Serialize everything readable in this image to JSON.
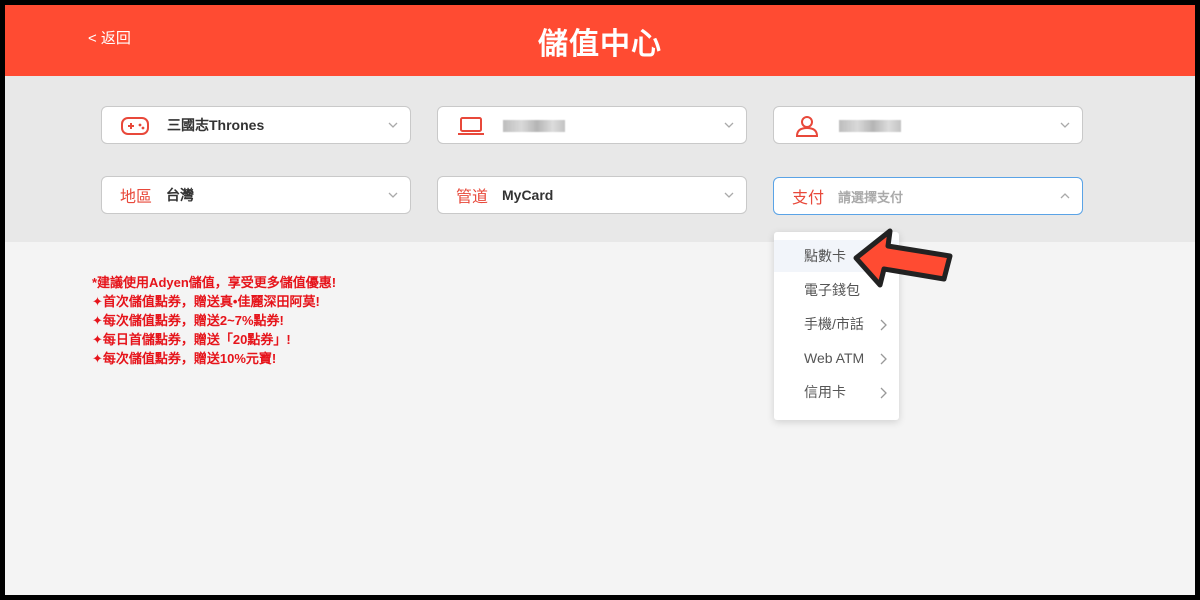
{
  "header": {
    "back_label": "< 返回",
    "title": "儲值中心",
    "bg_color": "#ff4b32"
  },
  "selectors": {
    "game": {
      "value": "三國志Thrones",
      "icon": "gamepad-icon"
    },
    "server": {
      "value": "",
      "icon": "laptop-icon"
    },
    "character": {
      "value": "",
      "icon": "user-icon"
    },
    "region": {
      "label": "地區",
      "value": "台灣"
    },
    "channel": {
      "label": "管道",
      "value": "MyCard"
    },
    "payment": {
      "label": "支付",
      "placeholder": "請選擇支付"
    }
  },
  "promo": {
    "lines": [
      "*建議使用Adyen儲值，享受更多儲值優惠!",
      "✦首次儲值點券，贈送真•佳麗深田阿莫!",
      "✦每次儲值點券，贈送2~7%點券!",
      "✦每日首儲點券，贈送「20點券」!",
      "✦每次儲值點券，贈送10%元寶!"
    ],
    "color": "#e6141b"
  },
  "payment_menu": {
    "items": [
      {
        "label": "點數卡",
        "has_submenu": false
      },
      {
        "label": "電子錢包",
        "has_submenu": false
      },
      {
        "label": "手機/市話",
        "has_submenu": true
      },
      {
        "label": "Web ATM",
        "has_submenu": true
      },
      {
        "label": "信用卡",
        "has_submenu": true
      }
    ]
  },
  "accent_color": "#e8483a"
}
